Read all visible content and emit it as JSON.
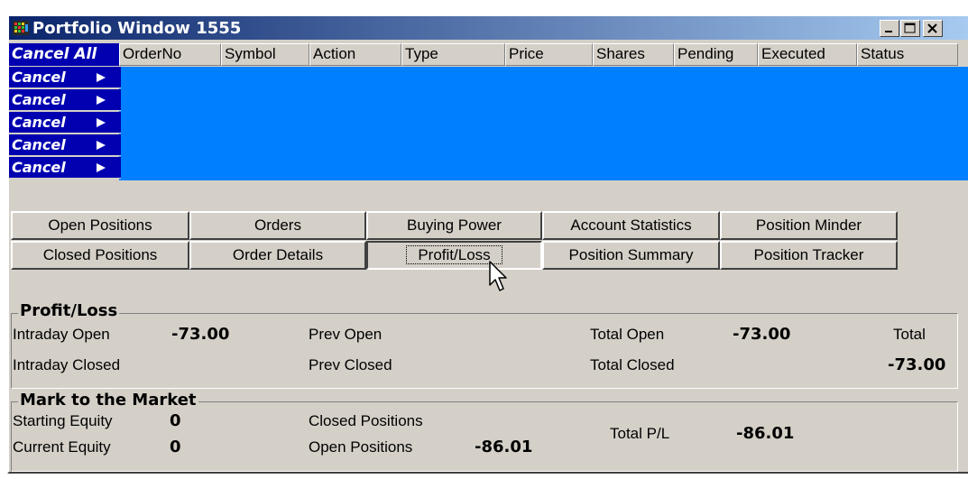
{
  "window": {
    "title": "Portfolio Window 1555"
  },
  "orders_grid": {
    "cancel_all_label": "Cancel All",
    "columns": [
      "OrderNo",
      "Symbol",
      "Action",
      "Type",
      "Price",
      "Shares",
      "Pending",
      "Executed",
      "Status"
    ],
    "cancel_rows": [
      "Cancel",
      "Cancel",
      "Cancel",
      "Cancel",
      "Cancel"
    ]
  },
  "tabs": {
    "row1": [
      "Open Positions",
      "Orders",
      "Buying Power",
      "Account Statistics",
      "Position Minder"
    ],
    "row2": [
      "Closed Positions",
      "Order Details",
      "Profit/Loss",
      "Position Summary",
      "Position Tracker"
    ],
    "selected": "Profit/Loss"
  },
  "profit_loss": {
    "title": "Profit/Loss",
    "intraday_open_label": "Intraday Open",
    "intraday_open_value": "-73.00",
    "intraday_closed_label": "Intraday Closed",
    "prev_open_label": "Prev Open",
    "prev_closed_label": "Prev Closed",
    "total_open_label": "Total Open",
    "total_open_value": "-73.00",
    "total_closed_label": "Total Closed",
    "total_label": "Total",
    "total_value": "-73.00"
  },
  "mark_to_market": {
    "title": "Mark to the Market",
    "starting_equity_label": "Starting Equity",
    "starting_equity_value": "0",
    "current_equity_label": "Current Equity",
    "current_equity_value": "0",
    "closed_positions_label": "Closed Positions",
    "open_positions_label": "Open Positions",
    "open_positions_value": "-86.01",
    "total_pl_label": "Total P/L",
    "total_pl_value": "-86.01"
  },
  "colors": {
    "title_bar": "#0a246a",
    "grid_blue": "#0080ff",
    "cancel_blue": "#0000b0",
    "face": "#d4d0c8"
  },
  "icons": [
    "app-icon",
    "minimize-icon",
    "maximize-icon",
    "close-icon",
    "play-arrow-icon",
    "mouse-pointer-icon"
  ]
}
